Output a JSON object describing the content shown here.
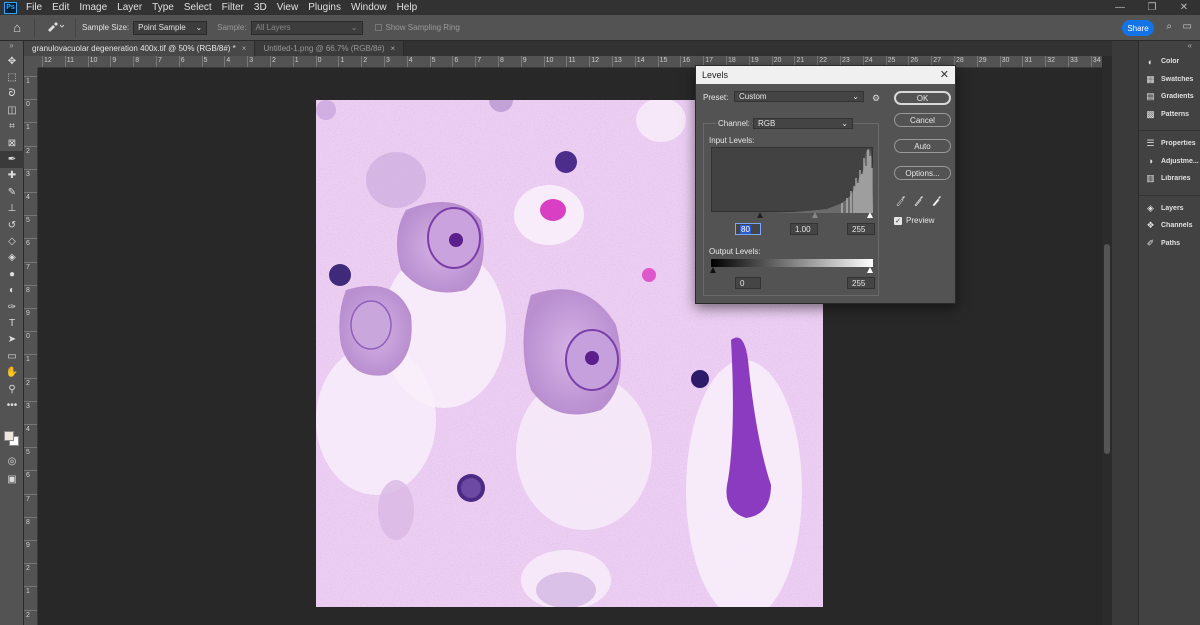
{
  "menubar": {
    "logo": "Ps",
    "items": [
      "File",
      "Edit",
      "Image",
      "Layer",
      "Type",
      "Select",
      "Filter",
      "3D",
      "View",
      "Plugins",
      "Window",
      "Help"
    ],
    "window_controls": [
      "—",
      "❐",
      "✕"
    ]
  },
  "options_bar": {
    "sample_size_label": "Sample Size:",
    "sample_size_value": "Point Sample",
    "sample_label": "Sample:",
    "sample_value": "All Layers",
    "show_ring_label": "Show Sampling Ring",
    "share_label": "Share"
  },
  "tabs": [
    {
      "title": "granulovacuolar degeneration 400x.tif @ 50% (RGB/8#) *",
      "active": true
    },
    {
      "title": "Untitled-1.png @ 66.7% (RGB/8#)",
      "active": false
    }
  ],
  "tools": [
    "move-tool-icon",
    "marquee-tool-icon",
    "lasso-tool-icon",
    "object-select-icon",
    "crop-tool-icon",
    "frame-tool-icon",
    "eyedropper-tool-icon",
    "healing-brush-icon",
    "brush-tool-icon",
    "clone-stamp-icon",
    "history-brush-icon",
    "eraser-tool-icon",
    "paint-bucket-icon",
    "blur-tool-icon",
    "dodge-tool-icon",
    "pen-tool-icon",
    "type-tool-icon",
    "path-select-icon",
    "rectangle-tool-icon",
    "hand-tool-icon",
    "zoom-tool-icon",
    "more-tools-icon"
  ],
  "ruler_h": [
    "12",
    "11",
    "10",
    "9",
    "8",
    "7",
    "6",
    "5",
    "4",
    "3",
    "2",
    "1",
    "0",
    "1",
    "2",
    "3",
    "4",
    "5",
    "6",
    "7",
    "8",
    "9",
    "10",
    "11",
    "12",
    "13",
    "14",
    "15",
    "16",
    "17",
    "18",
    "19",
    "20",
    "21",
    "22",
    "23",
    "24",
    "25",
    "26",
    "27",
    "28",
    "29",
    "30",
    "31",
    "32",
    "33",
    "34"
  ],
  "ruler_v": [
    "1",
    "0",
    "1",
    "2",
    "3",
    "4",
    "5",
    "6",
    "7",
    "8",
    "9",
    "0",
    "1",
    "2",
    "3",
    "4",
    "5",
    "6",
    "7",
    "8",
    "9",
    "2",
    "1",
    "2"
  ],
  "panels": {
    "group1": [
      {
        "label": "Color",
        "icon": "color-icon"
      },
      {
        "label": "Swatches",
        "icon": "swatches-icon"
      },
      {
        "label": "Gradients",
        "icon": "gradients-icon"
      },
      {
        "label": "Patterns",
        "icon": "patterns-icon"
      }
    ],
    "group2": [
      {
        "label": "Properties",
        "icon": "properties-icon"
      },
      {
        "label": "Adjustme...",
        "icon": "adjustments-icon"
      },
      {
        "label": "Libraries",
        "icon": "libraries-icon"
      }
    ],
    "group3": [
      {
        "label": "Layers",
        "icon": "layers-icon"
      },
      {
        "label": "Channels",
        "icon": "channels-icon"
      },
      {
        "label": "Paths",
        "icon": "paths-icon"
      }
    ]
  },
  "levels_dialog": {
    "title": "Levels",
    "preset_label": "Preset:",
    "preset_value": "Custom",
    "channel_label": "Channel:",
    "channel_value": "RGB",
    "input_levels_label": "Input Levels:",
    "input_black": "80",
    "input_gamma": "1.00",
    "input_white": "255",
    "output_levels_label": "Output Levels:",
    "output_black": "0",
    "output_white": "255",
    "buttons": {
      "ok": "OK",
      "cancel": "Cancel",
      "auto": "Auto",
      "options": "Options..."
    },
    "preview_label": "Preview",
    "preview_checked": true
  }
}
